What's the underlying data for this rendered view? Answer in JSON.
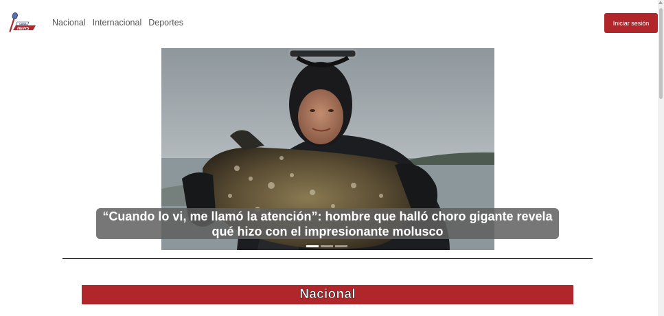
{
  "header": {
    "logo_text": "CASA NEWS",
    "nav": [
      "Nacional",
      "Internacional",
      "Deportes"
    ],
    "login_label": "Iniciar sesión"
  },
  "carousel": {
    "caption": "“Cuando lo vi, me llamó la atención”: hombre que halló choro gigante revela qué hizo con el impresionante molusco",
    "slide_count": 3,
    "active_index": 0
  },
  "section": {
    "title": "Nacional"
  },
  "colors": {
    "brand_red": "#b0262b"
  }
}
